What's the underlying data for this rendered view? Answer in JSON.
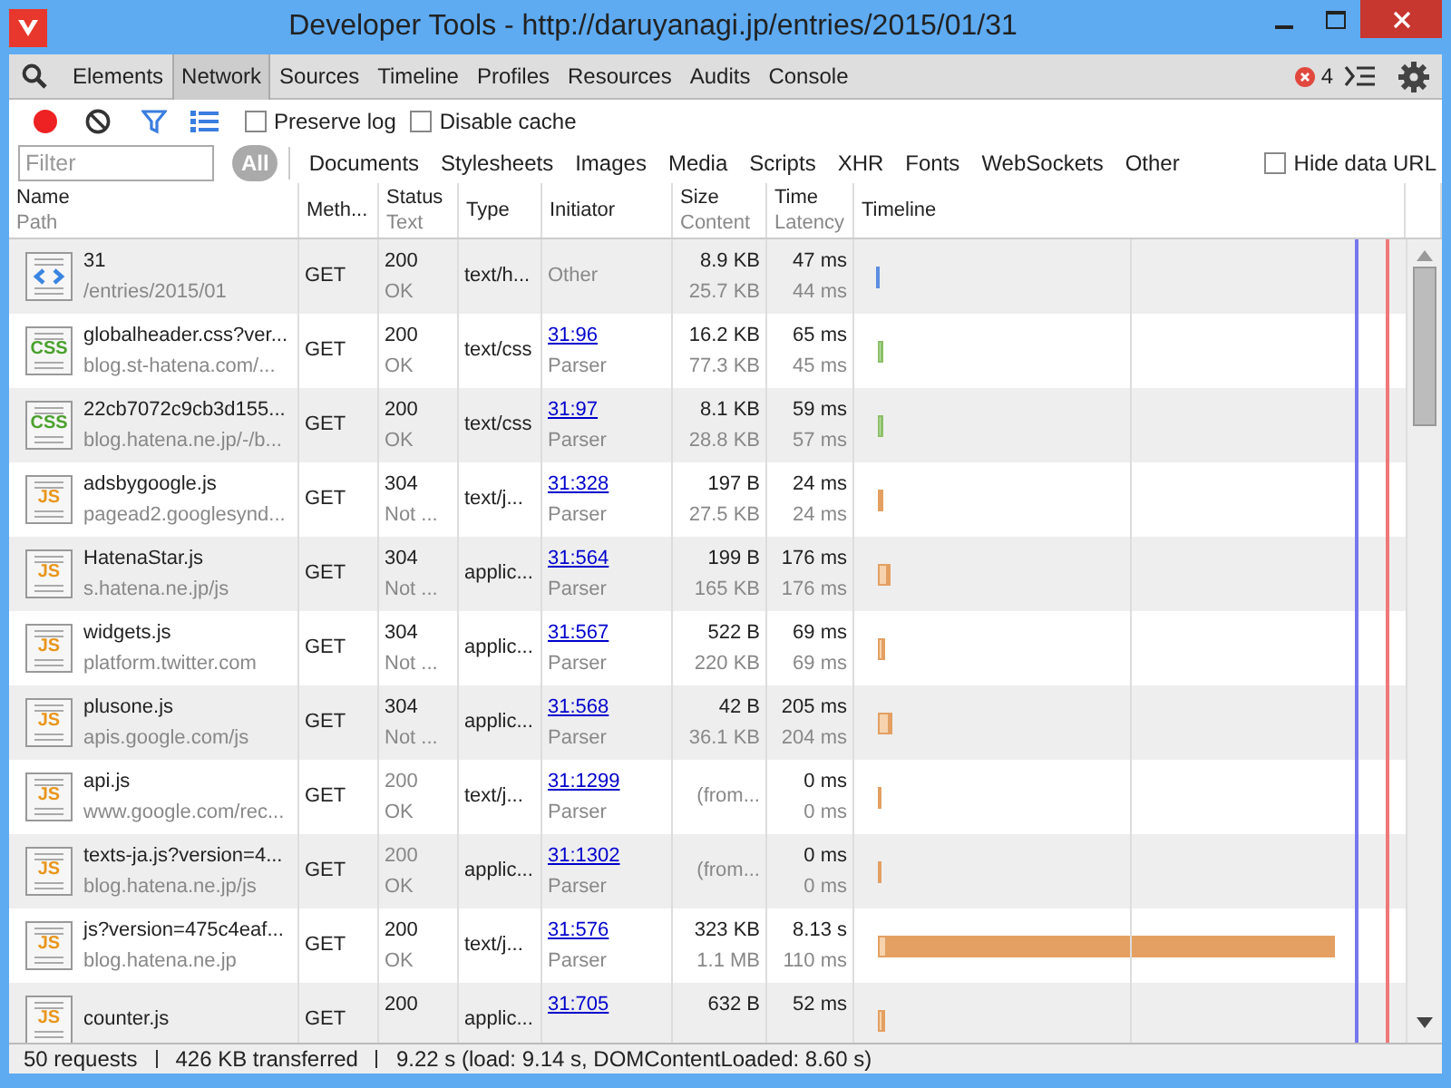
{
  "window": {
    "title": "Developer Tools - http://daruyanagi.jp/entries/2015/01/31"
  },
  "tabs": [
    {
      "label": "Elements",
      "selected": false
    },
    {
      "label": "Network",
      "selected": true
    },
    {
      "label": "Sources",
      "selected": false
    },
    {
      "label": "Timeline",
      "selected": false
    },
    {
      "label": "Profiles",
      "selected": false
    },
    {
      "label": "Resources",
      "selected": false
    },
    {
      "label": "Audits",
      "selected": false
    },
    {
      "label": "Console",
      "selected": false
    }
  ],
  "error_count": "4",
  "toolbar": {
    "recording": true,
    "filter_on": true,
    "options": [
      {
        "label": "Preserve log",
        "checked": false
      },
      {
        "label": "Disable cache",
        "checked": false
      }
    ]
  },
  "filter": {
    "placeholder": "Filter",
    "types": [
      {
        "label": "All",
        "selected": true
      },
      {
        "label": "Documents",
        "selected": false
      },
      {
        "label": "Stylesheets",
        "selected": false
      },
      {
        "label": "Images",
        "selected": false
      },
      {
        "label": "Media",
        "selected": false
      },
      {
        "label": "Scripts",
        "selected": false
      },
      {
        "label": "XHR",
        "selected": false
      },
      {
        "label": "Fonts",
        "selected": false
      },
      {
        "label": "WebSockets",
        "selected": false
      },
      {
        "label": "Other",
        "selected": false
      }
    ],
    "hide_data_url": {
      "label": "Hide data URL",
      "checked": false
    }
  },
  "columns": [
    {
      "title": "Name",
      "subtitle": "Path"
    },
    {
      "title": "Meth..."
    },
    {
      "title": "Status",
      "subtitle": "Text"
    },
    {
      "title": "Type"
    },
    {
      "title": "Initiator"
    },
    {
      "title": "Size",
      "subtitle": "Content"
    },
    {
      "title": "Time",
      "subtitle": "Latency"
    },
    {
      "title": "Timeline"
    }
  ],
  "rows": [
    {
      "kind": "html",
      "name": "31",
      "path": "/entries/2015/01",
      "method": "GET",
      "status": "200",
      "status_text": "OK",
      "cached": false,
      "type": "text/h...",
      "initiator": "Other",
      "initiator_link": false,
      "size": "8.9 KB",
      "content": "25.7 KB",
      "time": "47 ms",
      "latency": "44 ms"
    },
    {
      "kind": "css",
      "icon_text": "CSS",
      "name": "globalheader.css?ver...",
      "path": "blog.st-hatena.com/...",
      "method": "GET",
      "status": "200",
      "status_text": "OK",
      "cached": false,
      "type": "text/css",
      "initiator": "31:96",
      "initiator_link": true,
      "cause": "Parser",
      "size": "16.2 KB",
      "content": "77.3 KB",
      "time": "65 ms",
      "latency": "45 ms"
    },
    {
      "kind": "css",
      "icon_text": "CSS",
      "name": "22cb7072c9cb3d155...",
      "path": "blog.hatena.ne.jp/-/b...",
      "method": "GET",
      "status": "200",
      "status_text": "OK",
      "cached": false,
      "type": "text/css",
      "initiator": "31:97",
      "initiator_link": true,
      "cause": "Parser",
      "size": "8.1 KB",
      "content": "28.8 KB",
      "time": "59 ms",
      "latency": "57 ms"
    },
    {
      "kind": "js",
      "icon_text": "JS",
      "name": "adsbygoogle.js",
      "path": "pagead2.googlesynd...",
      "method": "GET",
      "status": "304",
      "status_text": "Not ...",
      "cached": false,
      "type": "text/j...",
      "initiator": "31:328",
      "initiator_link": true,
      "cause": "Parser",
      "size": "197 B",
      "content": "27.5 KB",
      "time": "24 ms",
      "latency": "24 ms"
    },
    {
      "kind": "js",
      "icon_text": "JS",
      "name": "HatenaStar.js",
      "path": "s.hatena.ne.jp/js",
      "method": "GET",
      "status": "304",
      "status_text": "Not ...",
      "cached": false,
      "type": "applic...",
      "initiator": "31:564",
      "initiator_link": true,
      "cause": "Parser",
      "size": "199 B",
      "content": "165 KB",
      "time": "176 ms",
      "latency": "176 ms"
    },
    {
      "kind": "js",
      "icon_text": "JS",
      "name": "widgets.js",
      "path": "platform.twitter.com",
      "method": "GET",
      "status": "304",
      "status_text": "Not ...",
      "cached": false,
      "type": "applic...",
      "initiator": "31:567",
      "initiator_link": true,
      "cause": "Parser",
      "size": "522 B",
      "content": "220 KB",
      "time": "69 ms",
      "latency": "69 ms"
    },
    {
      "kind": "js",
      "icon_text": "JS",
      "name": "plusone.js",
      "path": "apis.google.com/js",
      "method": "GET",
      "status": "304",
      "status_text": "Not ...",
      "cached": false,
      "type": "applic...",
      "initiator": "31:568",
      "initiator_link": true,
      "cause": "Parser",
      "size": "42 B",
      "content": "36.1 KB",
      "time": "205 ms",
      "latency": "204 ms"
    },
    {
      "kind": "js",
      "icon_text": "JS",
      "name": "api.js",
      "path": "www.google.com/rec...",
      "method": "GET",
      "status": "200",
      "status_text": "OK",
      "cached": true,
      "type": "text/j...",
      "initiator": "31:1299",
      "initiator_link": true,
      "cause": "Parser",
      "size": "(from...",
      "time": "0 ms",
      "latency": "0 ms"
    },
    {
      "kind": "js",
      "icon_text": "JS",
      "name": "texts-ja.js?version=4...",
      "path": "blog.hatena.ne.jp/js",
      "method": "GET",
      "status": "200",
      "status_text": "OK",
      "cached": true,
      "type": "applic...",
      "initiator": "31:1302",
      "initiator_link": true,
      "cause": "Parser",
      "size": "(from...",
      "time": "0 ms",
      "latency": "0 ms"
    },
    {
      "kind": "js",
      "icon_text": "JS",
      "name": "js?version=475c4eaf...",
      "path": "blog.hatena.ne.jp",
      "method": "GET",
      "status": "200",
      "status_text": "OK",
      "cached": false,
      "type": "text/j...",
      "initiator": "31:576",
      "initiator_link": true,
      "cause": "Parser",
      "size": "323 KB",
      "content": "1.1 MB",
      "time": "8.13 s",
      "latency": "110 ms"
    },
    {
      "kind": "js",
      "icon_text": "JS",
      "name": "counter.js",
      "method": "GET",
      "status": "200",
      "cached": false,
      "type": "applic...",
      "initiator": "31:705",
      "initiator_link": true,
      "size": "632 B",
      "time": "52 ms"
    }
  ],
  "status_bar": [
    "50 requests",
    "426 KB transferred",
    "9.22 s (load: 9.14 s, DOMContentLoaded: 8.60 s)"
  ]
}
